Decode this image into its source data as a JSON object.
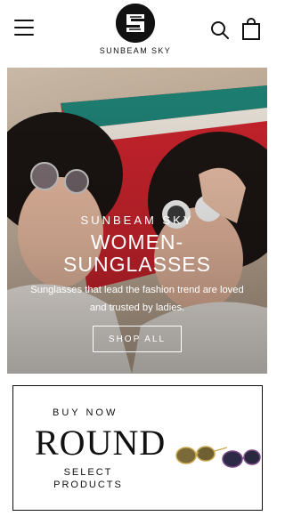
{
  "header": {
    "brand": "SUNBEAM SKY",
    "menu_icon": "hamburger-menu-icon",
    "search_icon": "search-icon",
    "cart_icon": "shopping-bag-icon"
  },
  "hero": {
    "brand": "SUNBEAM SKY",
    "title_line1": "WOMEN-",
    "title_line2": "SUNGLASSES",
    "subtitle": "Sunglasses that lead the fashion trend are loved and trusted by ladies.",
    "cta_label": "SHOP ALL"
  },
  "promo": {
    "buy_now": "BUY NOW",
    "headline": "ROUND",
    "select_products": "SELECT PRODUCTS"
  },
  "colors": {
    "text": "#111111",
    "hero_overlay_text": "#ffffff",
    "towel_red": "#c8232c"
  }
}
